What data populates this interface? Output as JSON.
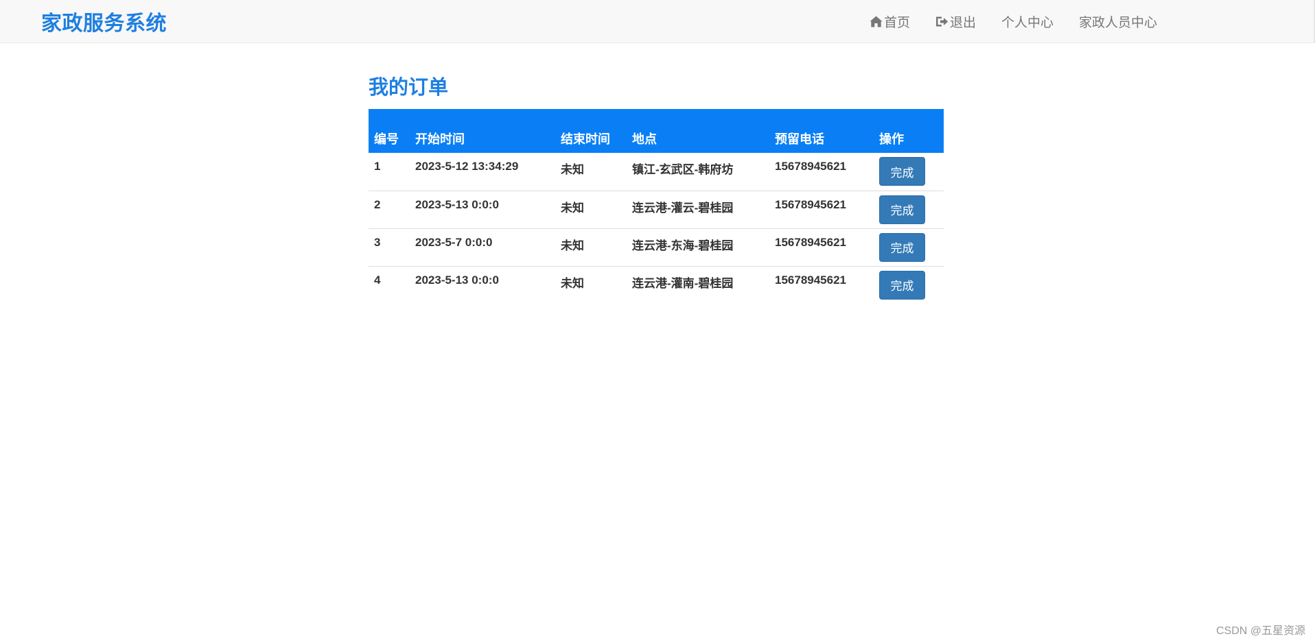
{
  "navbar": {
    "brand": "家政服务系统",
    "items": [
      {
        "label": "首页",
        "icon": "home-icon"
      },
      {
        "label": "退出",
        "icon": "logout-icon"
      },
      {
        "label": "个人中心",
        "icon": ""
      },
      {
        "label": "家政人员中心",
        "icon": ""
      }
    ]
  },
  "main": {
    "title": "我的订单",
    "table": {
      "headers": [
        "编号",
        "开始时间",
        "结束时间",
        "地点",
        "预留电话",
        "操作"
      ],
      "rows": [
        {
          "id": "1",
          "start": "2023-5-12 13:34:29",
          "end": "未知",
          "location": "镇江-玄武区-韩府坊",
          "phone": "15678945621",
          "action": "完成"
        },
        {
          "id": "2",
          "start": "2023-5-13 0:0:0",
          "end": "未知",
          "location": "连云港-灌云-碧桂园",
          "phone": "15678945621",
          "action": "完成"
        },
        {
          "id": "3",
          "start": "2023-5-7 0:0:0",
          "end": "未知",
          "location": "连云港-东海-碧桂园",
          "phone": "15678945621",
          "action": "完成"
        },
        {
          "id": "4",
          "start": "2023-5-13 0:0:0",
          "end": "未知",
          "location": "连云港-灌南-碧桂园",
          "phone": "15678945621",
          "action": "完成"
        }
      ]
    }
  },
  "watermark": "CSDN @五星资源",
  "colors": {
    "brand": "#1e7fe0",
    "table_header_bg": "#0a7ff5",
    "button_bg": "#337ab7",
    "navbar_bg": "#f8f8f8"
  }
}
